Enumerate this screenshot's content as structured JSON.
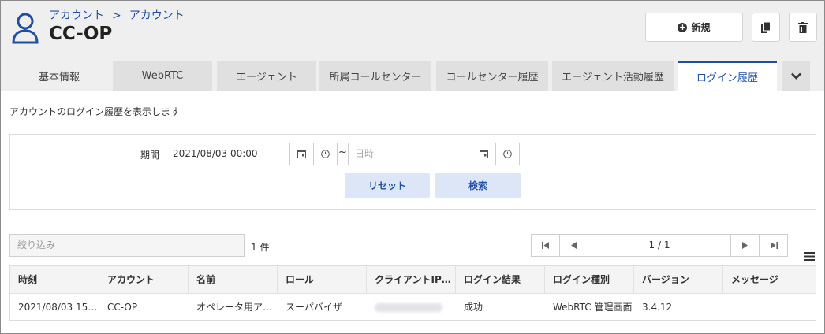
{
  "header": {
    "breadcrumb": [
      "アカウント",
      "アカウント"
    ],
    "breadcrumb_separator": ">",
    "title": "CC-OP",
    "new_button_label": "新規",
    "icons": [
      "user-icon",
      "copy-icon",
      "trash-icon",
      "plus-circle-icon"
    ]
  },
  "tabs": [
    {
      "label": "基本情報",
      "active": false
    },
    {
      "label": "WebRTC",
      "active": false
    },
    {
      "label": "エージェント",
      "active": false
    },
    {
      "label": "所属コールセンター",
      "active": false
    },
    {
      "label": "コールセンター履歴",
      "active": false
    },
    {
      "label": "エージェント活動履歴",
      "active": false
    },
    {
      "label": "ログイン履歴",
      "active": true
    }
  ],
  "description": "アカウントのログイン履歴を表示します",
  "search": {
    "period_label": "期間",
    "start_value": "2021/08/03 00:00",
    "end_placeholder": "日時",
    "separator": "~",
    "reset_label": "リセット",
    "search_label": "検索"
  },
  "list": {
    "filter_placeholder": "絞り込み",
    "count_text": "1 件",
    "pager_text": "1 / 1"
  },
  "table": {
    "columns": [
      "時刻",
      "アカウント",
      "名前",
      "ロール",
      "クライアントIP…",
      "ログイン結果",
      "ログイン種別",
      "バージョン",
      "メッセージ"
    ],
    "rows": [
      {
        "time": "2021/08/03 15…",
        "account": "CC-OP",
        "name": "オペレータ用ア…",
        "role": "スーパバイザ",
        "result": "成功",
        "type": "WebRTC 管理画面",
        "version": "3.4.12",
        "message": ""
      }
    ]
  },
  "colors": {
    "accent": "#1e4fa3",
    "header_bg": "#efefef",
    "tab_bg": "#e0e0e0",
    "button_light": "#dde6f7"
  }
}
